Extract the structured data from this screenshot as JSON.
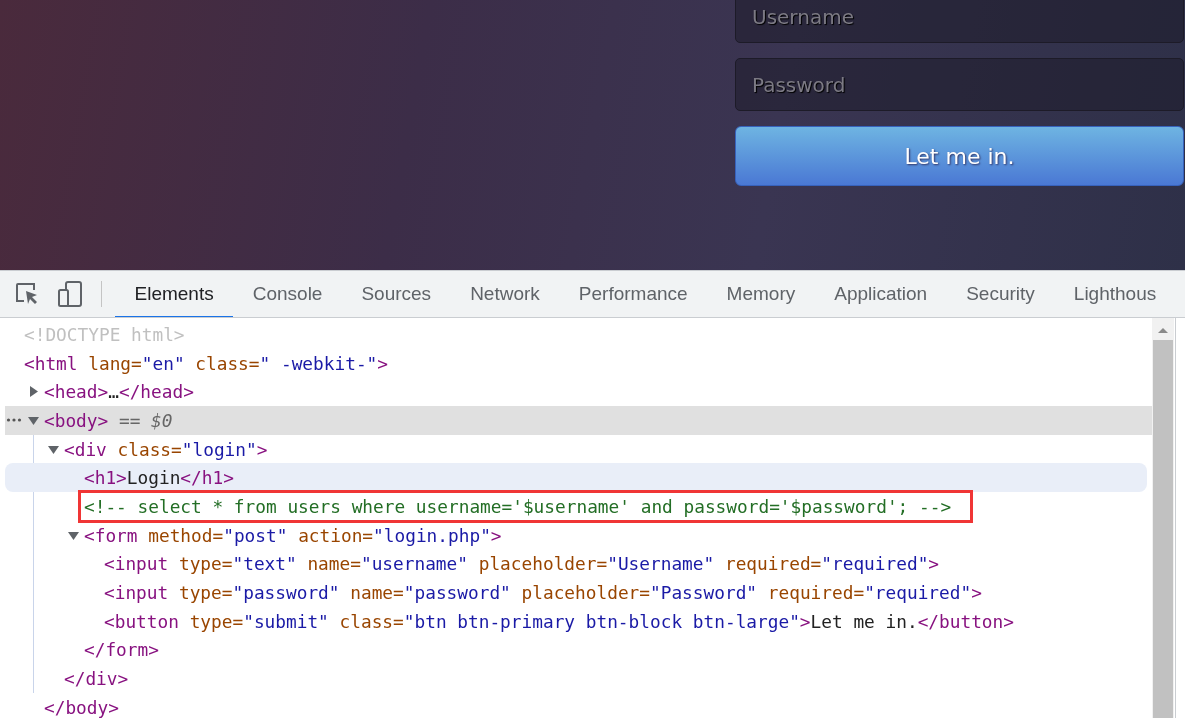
{
  "login_page": {
    "username_field": {
      "placeholder": "Username"
    },
    "password_field": {
      "placeholder": "Password"
    },
    "submit_button": {
      "label": "Let me in."
    }
  },
  "devtools": {
    "tabs": [
      {
        "label": "Elements",
        "selected": true
      },
      {
        "label": "Console",
        "selected": false
      },
      {
        "label": "Sources",
        "selected": false
      },
      {
        "label": "Network",
        "selected": false
      },
      {
        "label": "Performance",
        "selected": false
      },
      {
        "label": "Memory",
        "selected": false
      },
      {
        "label": "Application",
        "selected": false
      },
      {
        "label": "Security",
        "selected": false
      },
      {
        "label": "Lighthous",
        "selected": false
      }
    ],
    "tree": [
      {
        "line": [
          {
            "kind": "doctype",
            "text": "<!DOCTYPE html>"
          }
        ],
        "selected": false,
        "hovered": false,
        "annotated": false
      },
      {
        "line": [
          {
            "kind": "tag",
            "text": "<html"
          },
          {
            "kind": "attr",
            "text": " lang="
          },
          {
            "kind": "value",
            "text": "\"en\""
          },
          {
            "kind": "attr",
            "text": " class="
          },
          {
            "kind": "value",
            "text": "\" -webkit-\""
          },
          {
            "kind": "tag",
            "text": ">"
          }
        ],
        "selected": false,
        "hovered": false,
        "annotated": false,
        "children": [
          {
            "line": [
              {
                "kind": "tag",
                "text": "<head>"
              },
              {
                "kind": "text",
                "text": "…"
              },
              {
                "kind": "tag",
                "text": "</head>"
              }
            ],
            "expanded": false,
            "selected": false,
            "hovered": false,
            "annotated": false
          },
          {
            "line": [
              {
                "kind": "tag",
                "text": "<body>"
              },
              {
                "kind": "marker",
                "text": " == $0"
              }
            ],
            "expanded": true,
            "selected": true,
            "hovered": false,
            "annotated": false,
            "children": [
              {
                "line": [
                  {
                    "kind": "tag",
                    "text": "<div"
                  },
                  {
                    "kind": "attr",
                    "text": " class="
                  },
                  {
                    "kind": "value",
                    "text": "\"login\""
                  },
                  {
                    "kind": "tag",
                    "text": ">"
                  }
                ],
                "expanded": true,
                "selected": false,
                "hovered": false,
                "annotated": false,
                "children": [
                  {
                    "line": [
                      {
                        "kind": "tag",
                        "text": "<h1>"
                      },
                      {
                        "kind": "text",
                        "text": "Login"
                      },
                      {
                        "kind": "tag",
                        "text": "</h1>"
                      }
                    ],
                    "selected": false,
                    "hovered": true,
                    "annotated": false
                  },
                  {
                    "line": [
                      {
                        "kind": "comment",
                        "text": "<!-- select * from users where username='$username' and password='$password'; -->"
                      }
                    ],
                    "selected": false,
                    "hovered": false,
                    "annotated": true
                  },
                  {
                    "line": [
                      {
                        "kind": "tag",
                        "text": "<form"
                      },
                      {
                        "kind": "attr",
                        "text": " method="
                      },
                      {
                        "kind": "value",
                        "text": "\"post\""
                      },
                      {
                        "kind": "attr",
                        "text": " action="
                      },
                      {
                        "kind": "value",
                        "text": "\"login.php\""
                      },
                      {
                        "kind": "tag",
                        "text": ">"
                      }
                    ],
                    "expanded": true,
                    "selected": false,
                    "hovered": false,
                    "annotated": false,
                    "children": [
                      {
                        "line": [
                          {
                            "kind": "tag",
                            "text": "<input"
                          },
                          {
                            "kind": "attr",
                            "text": " type="
                          },
                          {
                            "kind": "value",
                            "text": "\"text\""
                          },
                          {
                            "kind": "attr",
                            "text": " name="
                          },
                          {
                            "kind": "value",
                            "text": "\"username\""
                          },
                          {
                            "kind": "attr",
                            "text": " placeholder="
                          },
                          {
                            "kind": "value",
                            "text": "\"Username\""
                          },
                          {
                            "kind": "attr",
                            "text": " required="
                          },
                          {
                            "kind": "value",
                            "text": "\"required\""
                          },
                          {
                            "kind": "tag",
                            "text": ">"
                          }
                        ],
                        "selected": false,
                        "hovered": false,
                        "annotated": false
                      },
                      {
                        "line": [
                          {
                            "kind": "tag",
                            "text": "<input"
                          },
                          {
                            "kind": "attr",
                            "text": " type="
                          },
                          {
                            "kind": "value",
                            "text": "\"password\""
                          },
                          {
                            "kind": "attr",
                            "text": " name="
                          },
                          {
                            "kind": "value",
                            "text": "\"password\""
                          },
                          {
                            "kind": "attr",
                            "text": " placeholder="
                          },
                          {
                            "kind": "value",
                            "text": "\"Password\""
                          },
                          {
                            "kind": "attr",
                            "text": " required="
                          },
                          {
                            "kind": "value",
                            "text": "\"required\""
                          },
                          {
                            "kind": "tag",
                            "text": ">"
                          }
                        ],
                        "selected": false,
                        "hovered": false,
                        "annotated": false
                      },
                      {
                        "line": [
                          {
                            "kind": "tag",
                            "text": "<button"
                          },
                          {
                            "kind": "attr",
                            "text": " type="
                          },
                          {
                            "kind": "value",
                            "text": "\"submit\""
                          },
                          {
                            "kind": "attr",
                            "text": " class="
                          },
                          {
                            "kind": "value",
                            "text": "\"btn btn-primary btn-block btn-large\""
                          },
                          {
                            "kind": "tag",
                            "text": ">"
                          },
                          {
                            "kind": "text",
                            "text": "Let me in."
                          },
                          {
                            "kind": "tag",
                            "text": "</button>"
                          }
                        ],
                        "selected": false,
                        "hovered": false,
                        "annotated": false
                      }
                    ],
                    "closing": [
                      {
                        "kind": "tag",
                        "text": "</form>"
                      }
                    ]
                  }
                ],
                "closing": [
                  {
                    "kind": "tag",
                    "text": "</div>"
                  }
                ]
              }
            ],
            "closing": [
              {
                "kind": "tag",
                "text": "</body>"
              }
            ]
          }
        ]
      }
    ]
  }
}
